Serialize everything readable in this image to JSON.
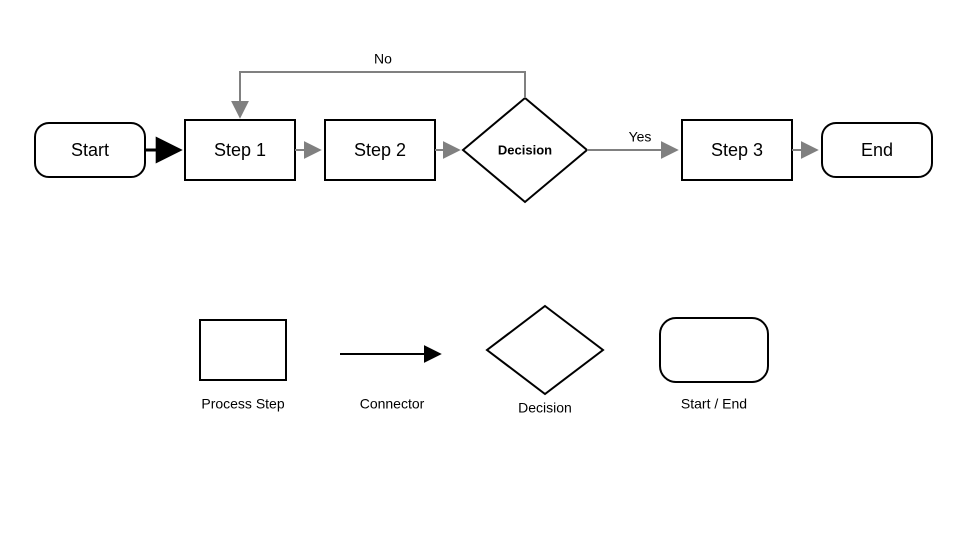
{
  "flow": {
    "nodes": {
      "start": {
        "label": "Start"
      },
      "step1": {
        "label": "Step 1"
      },
      "step2": {
        "label": "Step 2"
      },
      "decision": {
        "label": "Decision"
      },
      "step3": {
        "label": "Step 3"
      },
      "end": {
        "label": "End"
      }
    },
    "edges": {
      "yes": {
        "label": "Yes"
      },
      "no": {
        "label": "No"
      }
    }
  },
  "legend": {
    "process": {
      "label": "Process Step"
    },
    "connector": {
      "label": "Connector"
    },
    "decision": {
      "label": "Decision"
    },
    "terminal": {
      "label": "Start / End"
    }
  }
}
